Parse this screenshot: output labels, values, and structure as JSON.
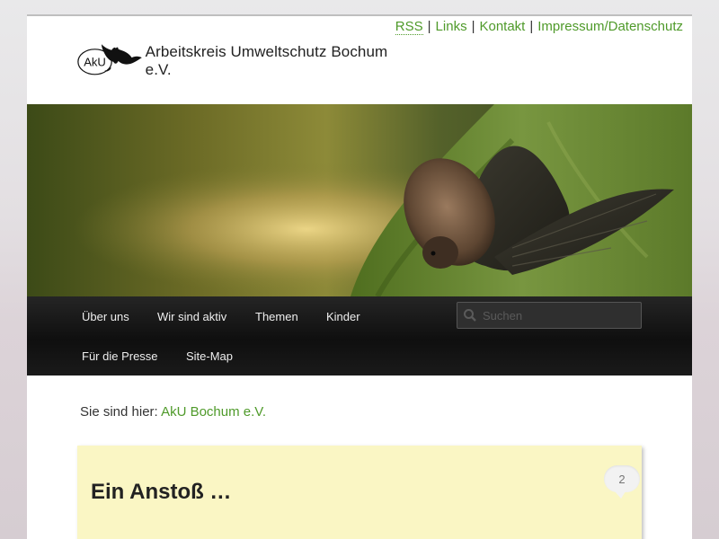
{
  "header": {
    "top_links": [
      {
        "label": "RSS"
      },
      {
        "label": "Links"
      },
      {
        "label": "Kontakt"
      },
      {
        "label": "Impressum/Datenschutz"
      }
    ],
    "logo_initials": "AkU",
    "site_name": "Arbeitskreis Umweltschutz Bochum e.V."
  },
  "nav": {
    "items": [
      {
        "label": "Über uns"
      },
      {
        "label": "Wir sind aktiv"
      },
      {
        "label": "Themen"
      },
      {
        "label": "Kinder"
      },
      {
        "label": "Für die Presse"
      },
      {
        "label": "Site-Map"
      }
    ],
    "search_placeholder": "Suchen"
  },
  "breadcrumb": {
    "prefix": "Sie sind hier: ",
    "link": "AkU Bochum e.V."
  },
  "post": {
    "title": "Ein Anstoß …",
    "comment_count": "2"
  },
  "colors": {
    "link_green": "#4f9a2a",
    "post_bg": "#faf6c4",
    "nav_bg": "#151515"
  }
}
